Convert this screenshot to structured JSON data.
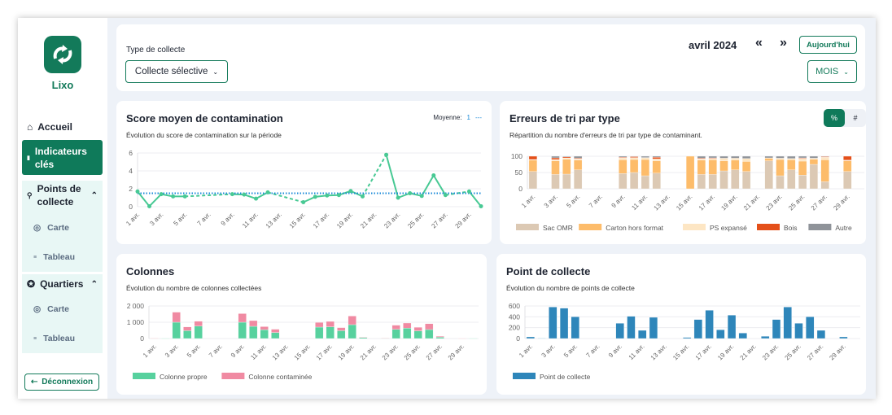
{
  "app": {
    "name": "Lixo"
  },
  "sidebar": {
    "home": "Accueil",
    "indicators": "Indicateurs clés",
    "points": "Points de collecte",
    "map": "Carte",
    "table": "Tableau",
    "districts": "Quartiers",
    "logout": "Déconnexion"
  },
  "header": {
    "type_label": "Type de collecte",
    "type_value": "Collecte sélective",
    "period": "avril 2024",
    "prev": "«",
    "next": "»",
    "today": "Aujourd'hui",
    "view": "MOIS"
  },
  "colors": {
    "brand": "#137a5a",
    "score": "#48c994",
    "mean": "#1a8ad8",
    "sac": "#dcc9b4",
    "carton": "#fdbc6a",
    "ps": "#fde6c4",
    "bois": "#e4501a",
    "autre": "#8f9399",
    "propre": "#57d19e",
    "contaminee": "#f08aa2",
    "points": "#2e86ba"
  },
  "chart_data": [
    {
      "type": "line",
      "title": "Score moyen de contamination",
      "subtitle": "Évolution du score de contamination sur la période",
      "legend": {
        "label": "Moyenne:",
        "value": "1"
      },
      "mean": 1.5,
      "ylim": [
        0,
        6
      ],
      "yticks": [
        "0",
        "2",
        "4",
        "6"
      ],
      "x": [
        "1 avr.",
        "2 avr.",
        "3 avr.",
        "4 avr.",
        "5 avr.",
        "6 avr.",
        "7 avr.",
        "8 avr.",
        "9 avr.",
        "10 avr.",
        "11 avr.",
        "12 avr.",
        "13 avr.",
        "14 avr.",
        "15 avr.",
        "16 avr.",
        "17 avr.",
        "18 avr.",
        "19 avr.",
        "20 avr.",
        "21 avr.",
        "22 avr.",
        "23 avr.",
        "24 avr.",
        "25 avr.",
        "26 avr.",
        "27 avr.",
        "28 avr.",
        "29 avr.",
        "30 avr."
      ],
      "values": [
        1.7,
        0.05,
        1.4,
        1.15,
        1.15,
        null,
        null,
        null,
        1.4,
        1.35,
        0.9,
        1.6,
        null,
        null,
        0.5,
        1.1,
        1.25,
        1.3,
        1.75,
        1.15,
        null,
        5.8,
        1.0,
        1.5,
        1.2,
        3.5,
        1.3,
        null,
        1.7,
        0.05
      ]
    },
    {
      "type": "bar",
      "stacked": true,
      "title": "Erreurs de tri par type",
      "subtitle": "Répartition du nombre d'erreurs de tri par type de contaminant.",
      "toggle": [
        "%",
        "#"
      ],
      "ylim": [
        0,
        100
      ],
      "yticks": [
        "0",
        "50",
        "100"
      ],
      "days": [
        1,
        3,
        4,
        5,
        9,
        10,
        11,
        12,
        15,
        16,
        17,
        18,
        19,
        20,
        22,
        23,
        24,
        25,
        26,
        27,
        29
      ],
      "series": [
        {
          "name": "Sac OMR",
          "color": "sac",
          "values": [
            53,
            44,
            45,
            58,
            47,
            50,
            40,
            48,
            0,
            44,
            44,
            55,
            58,
            53,
            86,
            40,
            58,
            42,
            75,
            22,
            53
          ]
        },
        {
          "name": "Carton hors format",
          "color": "carton",
          "values": [
            35,
            42,
            46,
            30,
            42,
            40,
            50,
            38,
            100,
            44,
            45,
            31,
            30,
            31,
            8,
            50,
            31,
            43,
            16,
            67,
            33
          ]
        },
        {
          "name": "PS expansé",
          "color": "ps",
          "values": [
            2,
            4,
            4,
            4,
            6,
            6,
            6,
            6,
            0,
            4,
            4,
            8,
            6,
            9,
            1,
            4,
            4,
            8,
            3,
            8,
            2
          ]
        },
        {
          "name": "Bois",
          "color": "bois",
          "values": [
            10,
            5,
            3,
            2,
            2,
            3,
            0,
            5,
            0,
            2,
            2,
            0,
            0,
            0,
            0,
            0,
            0,
            2,
            0,
            2,
            12
          ]
        },
        {
          "name": "Autre",
          "color": "autre",
          "values": [
            0,
            5,
            2,
            6,
            3,
            1,
            4,
            3,
            0,
            6,
            5,
            6,
            6,
            7,
            5,
            6,
            7,
            5,
            6,
            1,
            0
          ]
        }
      ]
    },
    {
      "type": "bar",
      "stacked": true,
      "title": "Colonnes",
      "subtitle": "Évolution du nombre de colonnes collectées",
      "ylim": [
        0,
        2000
      ],
      "yticks": [
        "0",
        "1 000",
        "2 000"
      ],
      "days": [
        1,
        2,
        3,
        4,
        5,
        9,
        10,
        11,
        12,
        16,
        17,
        18,
        19,
        20,
        22,
        23,
        24,
        25,
        26,
        27,
        29,
        30
      ],
      "series": [
        {
          "name": "Colonne propre",
          "color": "propre",
          "values": [
            10,
            10,
            1000,
            480,
            760,
            1000,
            750,
            540,
            370,
            700,
            720,
            480,
            850,
            60,
            20,
            560,
            640,
            470,
            550,
            80,
            5,
            10
          ]
        },
        {
          "name": "Colonne contaminée",
          "color": "contaminee",
          "values": [
            10,
            0,
            620,
            230,
            300,
            530,
            350,
            190,
            200,
            290,
            330,
            190,
            530,
            30,
            20,
            260,
            310,
            220,
            360,
            60,
            5,
            0
          ]
        }
      ]
    },
    {
      "type": "bar",
      "title": "Point de collecte",
      "subtitle": "Évolution du nombre de points de collecte",
      "ylim": [
        0,
        600
      ],
      "yticks": [
        "0",
        "200",
        "400",
        "600"
      ],
      "days": [
        1,
        2,
        3,
        4,
        5,
        9,
        10,
        11,
        12,
        15,
        16,
        17,
        18,
        19,
        20,
        22,
        23,
        24,
        25,
        26,
        27,
        29
      ],
      "series": [
        {
          "name": "Point de collecte",
          "color": "points",
          "values": [
            30,
            5,
            580,
            560,
            400,
            280,
            410,
            150,
            390,
            20,
            350,
            520,
            160,
            430,
            100,
            40,
            350,
            580,
            280,
            400,
            150,
            30
          ]
        }
      ]
    }
  ]
}
